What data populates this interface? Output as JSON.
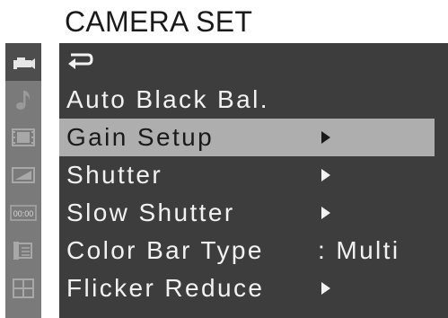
{
  "title": "CAMERA SET",
  "sidebar": {
    "icons": [
      {
        "name": "camera-icon",
        "active": true
      },
      {
        "name": "music-note-icon",
        "active": false
      },
      {
        "name": "film-icon",
        "active": false
      },
      {
        "name": "display-icon",
        "active": false
      },
      {
        "name": "timecode-icon",
        "active": false
      },
      {
        "name": "media-icon",
        "active": false
      },
      {
        "name": "grid-icon",
        "active": false
      }
    ],
    "timecode_text": "00:00"
  },
  "menu": {
    "items": [
      {
        "label": "",
        "icon": "return-icon"
      },
      {
        "label": "Auto Black Bal."
      },
      {
        "label": "Gain Setup",
        "has_submenu": true,
        "selected": true
      },
      {
        "label": "Shutter",
        "has_submenu": true
      },
      {
        "label": "Slow Shutter",
        "has_submenu": true
      },
      {
        "label": "Color Bar Type",
        "value": ": Multi"
      },
      {
        "label": "Flicker Reduce",
        "has_submenu": true
      }
    ]
  }
}
